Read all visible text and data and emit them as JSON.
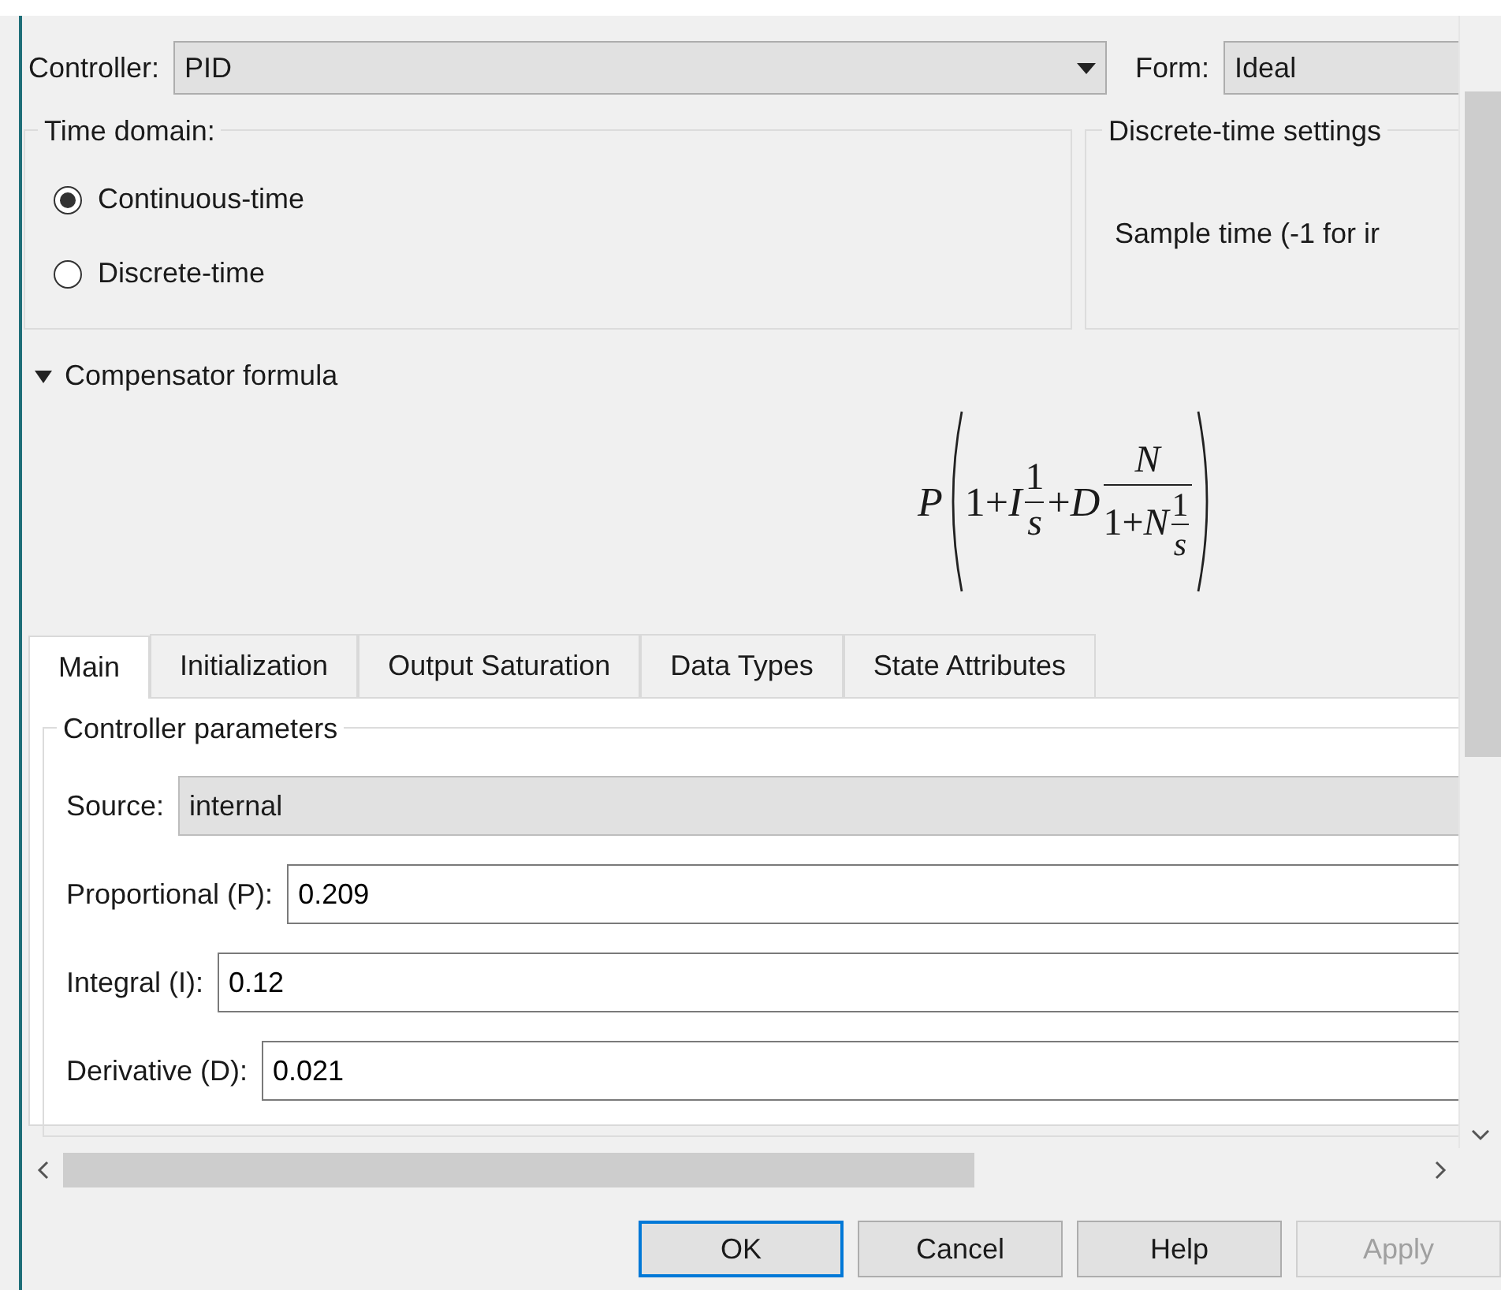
{
  "controller": {
    "label": "Controller:",
    "value": "PID"
  },
  "form": {
    "label": "Form:",
    "value": "Ideal"
  },
  "time_domain": {
    "title": "Time domain:",
    "options": [
      {
        "label": "Continuous-time",
        "selected": true
      },
      {
        "label": "Discrete-time",
        "selected": false
      }
    ]
  },
  "discrete_time_settings": {
    "title": "Discrete-time settings",
    "sample_time_label": "Sample time (-1 for ir"
  },
  "compensator_formula": {
    "label": "Compensator formula",
    "expanded": true,
    "formula": {
      "factor": "P",
      "integral_term": {
        "prefix": "1+*I*",
        "numerator": "1",
        "denominator": "*s*"
      },
      "derivative_term": {
        "prefix": "+*D*",
        "numerator": "*N*",
        "denominator": {
          "prefix": "1+*N*",
          "numerator": "1",
          "denominator": "*s*"
        }
      }
    }
  },
  "tabs": [
    {
      "label": "Main",
      "selected": true
    },
    {
      "label": "Initialization",
      "selected": false
    },
    {
      "label": "Output Saturation",
      "selected": false
    },
    {
      "label": "Data Types",
      "selected": false
    },
    {
      "label": "State Attributes",
      "selected": false
    }
  ],
  "controller_parameters": {
    "title": "Controller parameters",
    "source": {
      "label": "Source:",
      "value": "internal"
    },
    "fields": [
      {
        "label": "Proportional (P):",
        "value": "0.209"
      },
      {
        "label": "Integral (I):",
        "value": "0.12"
      },
      {
        "label": "Derivative (D):",
        "value": "0.021"
      }
    ]
  },
  "buttons": [
    {
      "label": "OK",
      "focused": true,
      "disabled": false
    },
    {
      "label": "Cancel",
      "focused": false,
      "disabled": false
    },
    {
      "label": "Help",
      "focused": false,
      "disabled": false
    },
    {
      "label": "Apply",
      "focused": false,
      "disabled": true
    }
  ]
}
